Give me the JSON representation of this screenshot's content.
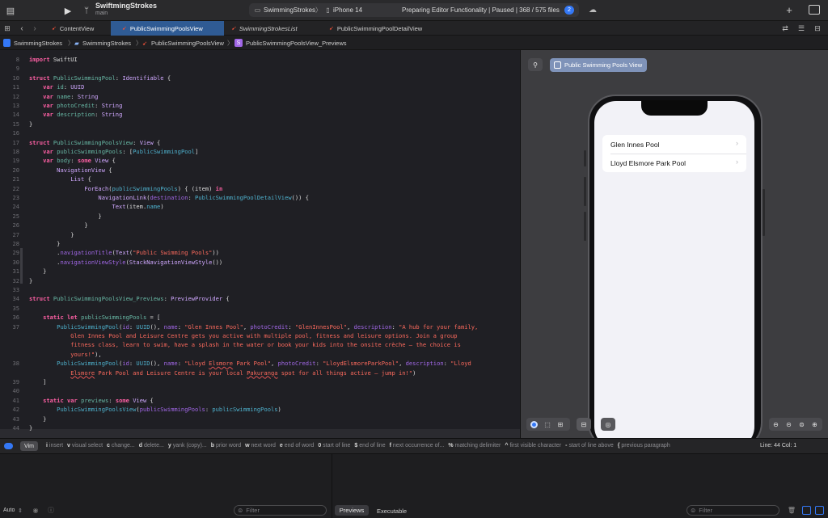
{
  "window": {
    "project_name": "SwiftmingStrokes",
    "branch": "main",
    "scheme": "SwimmingStrokes",
    "device": "iPhone 14",
    "status": "Preparing Editor Functionality | Paused | 368 / 575 files",
    "status_badge": "2"
  },
  "tabs": [
    {
      "label": "ContentView"
    },
    {
      "label": "PublicSwimmingPoolsView"
    },
    {
      "label": "SwimmingStrokesList"
    },
    {
      "label": "PublicSwimmingPoolDetailView"
    }
  ],
  "breadcrumb": [
    "SwimmingStrokes",
    "SwimmingStrokes",
    "PublicSwimmingPoolsView",
    "PublicSwimmingPoolsView_Previews"
  ],
  "code": {
    "line_numbers": [
      "8",
      "9",
      "10",
      "11",
      "12",
      "13",
      "14",
      "15",
      "16",
      "17",
      "18",
      "19",
      "20",
      "21",
      "22",
      "23",
      "24",
      "25",
      "26",
      "27",
      "28",
      "29",
      "30",
      "31",
      "32",
      "33",
      "34",
      "35",
      "36",
      "37",
      "",
      "",
      "",
      "38",
      "",
      "39",
      "40",
      "41",
      "42",
      "43",
      "44"
    ]
  },
  "preview": {
    "pin_label": "Public Swimming Pools View",
    "list_items": [
      "Glen Innes Pool",
      "Lloyd Elsmore Park Pool"
    ]
  },
  "vim": {
    "mode": "Vim",
    "hints": [
      {
        "key": "i",
        "text": "insert"
      },
      {
        "key": "v",
        "text": "visual select"
      },
      {
        "key": "c",
        "text": "change..."
      },
      {
        "key": "d",
        "text": "delete..."
      },
      {
        "key": "y",
        "text": "yank (copy)..."
      },
      {
        "key": "b",
        "text": "prior word"
      },
      {
        "key": "w",
        "text": "next word"
      },
      {
        "key": "e",
        "text": "end of word"
      },
      {
        "key": "0",
        "text": "start of line"
      },
      {
        "key": "$",
        "text": "end of line"
      },
      {
        "key": "f",
        "text": "next occurrence of..."
      },
      {
        "key": "%",
        "text": "matching delimiter"
      },
      {
        "key": "^",
        "text": "first visible character"
      },
      {
        "key": "-",
        "text": "start of line above"
      },
      {
        "key": "{",
        "text": "previous paragraph"
      }
    ],
    "position": "Line: 44  Col: 1"
  },
  "debug": {
    "auto_label": "Auto",
    "filter_placeholder": "Filter",
    "previews_tab": "Previews",
    "executable_tab": "Executable"
  },
  "colors": {
    "accent": "#3478f6",
    "keyword": "#fc5fa3",
    "string": "#fc6a5d"
  }
}
